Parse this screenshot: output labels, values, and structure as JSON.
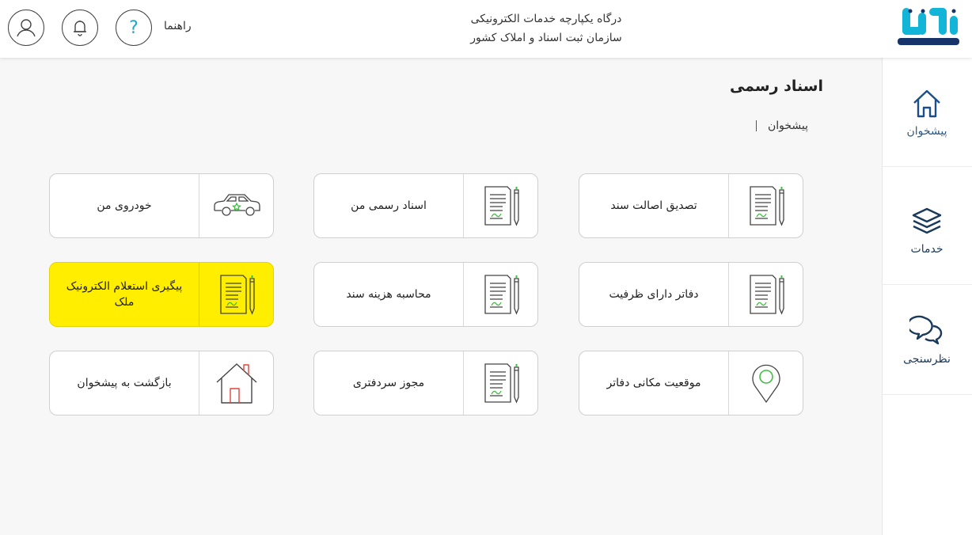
{
  "header": {
    "title_line1": "درگاه یکپارچه خدمات الکترونیکی",
    "title_line2": "سازمان ثبت اسناد و املاک کشور",
    "help_label": "راهنما",
    "icons": [
      "user-icon",
      "bell-icon",
      "help-icon"
    ],
    "logo_text": "ثبت من"
  },
  "sidebar": {
    "items": [
      {
        "label": "پیشخوان",
        "icon": "home-icon"
      },
      {
        "label": "خدمات",
        "icon": "layers-icon"
      },
      {
        "label": "نظرسنجی",
        "icon": "chat-icon"
      }
    ]
  },
  "page": {
    "title": "اسناد رسمی",
    "breadcrumb": "پیشخوان"
  },
  "cards": [
    {
      "label": "تصدیق اصالت سند",
      "icon": "document-pen-icon"
    },
    {
      "label": "اسناد رسمی من",
      "icon": "document-pen-icon"
    },
    {
      "label": "خودروی من",
      "icon": "car-icon"
    },
    {
      "label": "دفاتر دارای ظرفیت",
      "icon": "document-pen-icon"
    },
    {
      "label": "محاسبه هزینه سند",
      "icon": "document-pen-icon"
    },
    {
      "label": "پیگیری استعلام الکترونیک ملک",
      "icon": "document-pen-icon",
      "highlighted": true
    },
    {
      "label": "موقعیت مکانی دفاتر",
      "icon": "location-pin-icon"
    },
    {
      "label": "مجوز سردفتری",
      "icon": "document-pen-icon"
    },
    {
      "label": "بازگشت به پیشخوان",
      "icon": "house-icon"
    }
  ],
  "colors": {
    "accent_blue": "#1a4f8a",
    "logo_cyan": "#12b5d8",
    "pen_green": "#3fbf3f",
    "highlight": "#ffee00"
  }
}
